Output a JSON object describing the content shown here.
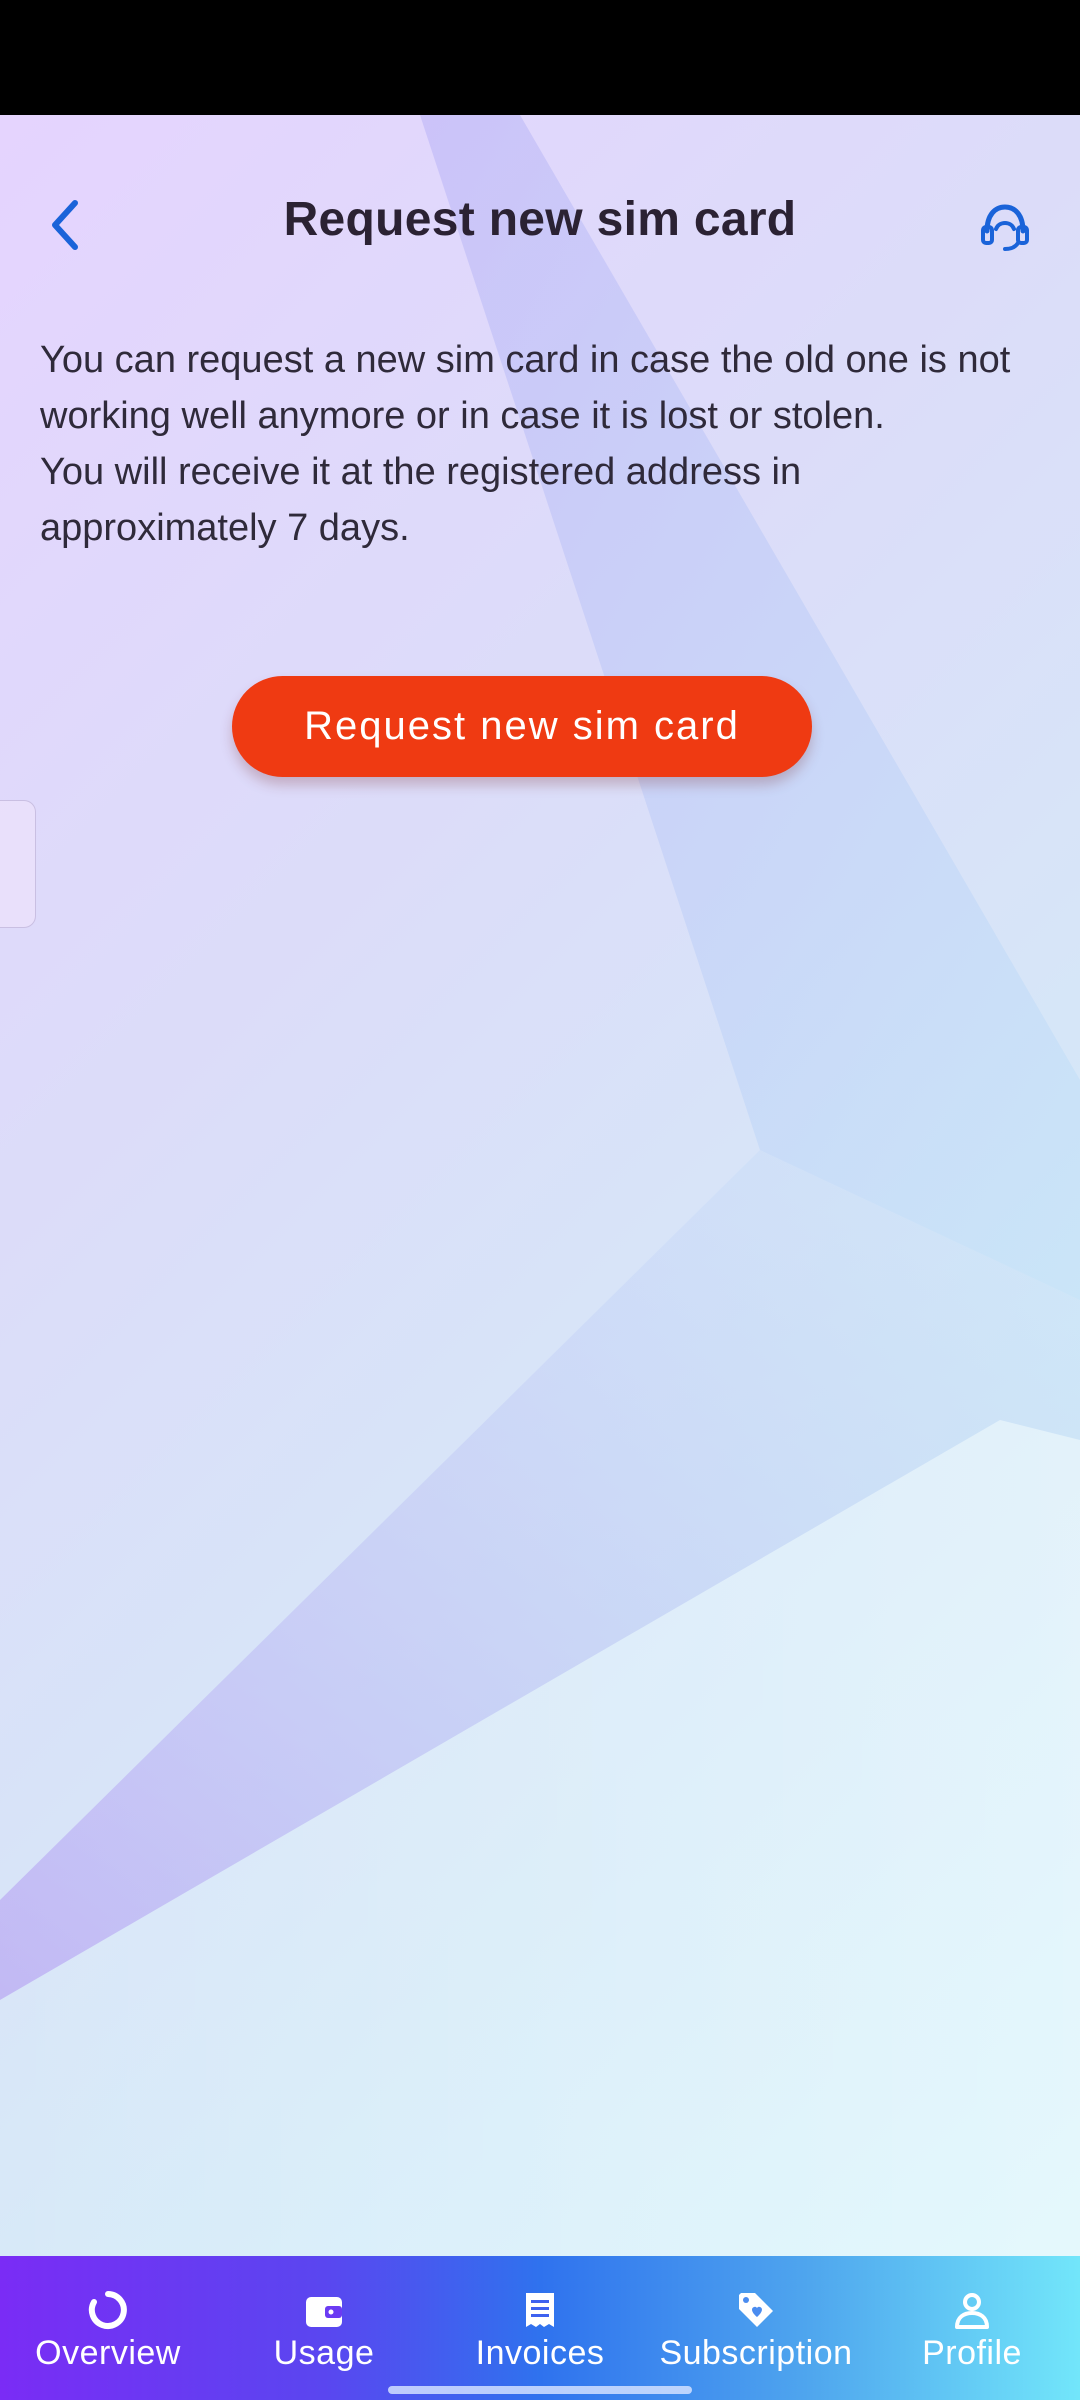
{
  "header": {
    "title": "Request new sim card",
    "back_icon": "chevron-left-icon",
    "support_icon": "headset-support-icon"
  },
  "content": {
    "paragraph_1": "You can request a new sim card in case the old one is not working well anymore or in case it is lost or stolen.",
    "paragraph_2": "You will receive it at the registered address in approximately 7 days."
  },
  "cta": {
    "label": "Request new sim card"
  },
  "bottom_nav": {
    "items": [
      {
        "label": "Overview",
        "icon": "ring-chart-icon"
      },
      {
        "label": "Usage",
        "icon": "wallet-icon"
      },
      {
        "label": "Invoices",
        "icon": "receipt-icon"
      },
      {
        "label": "Subscription",
        "icon": "tag-heart-icon"
      },
      {
        "label": "Profile",
        "icon": "person-icon"
      }
    ]
  },
  "colors": {
    "accent": "#1a63d9",
    "cta": "#ef3a12",
    "title": "#2b2233"
  }
}
